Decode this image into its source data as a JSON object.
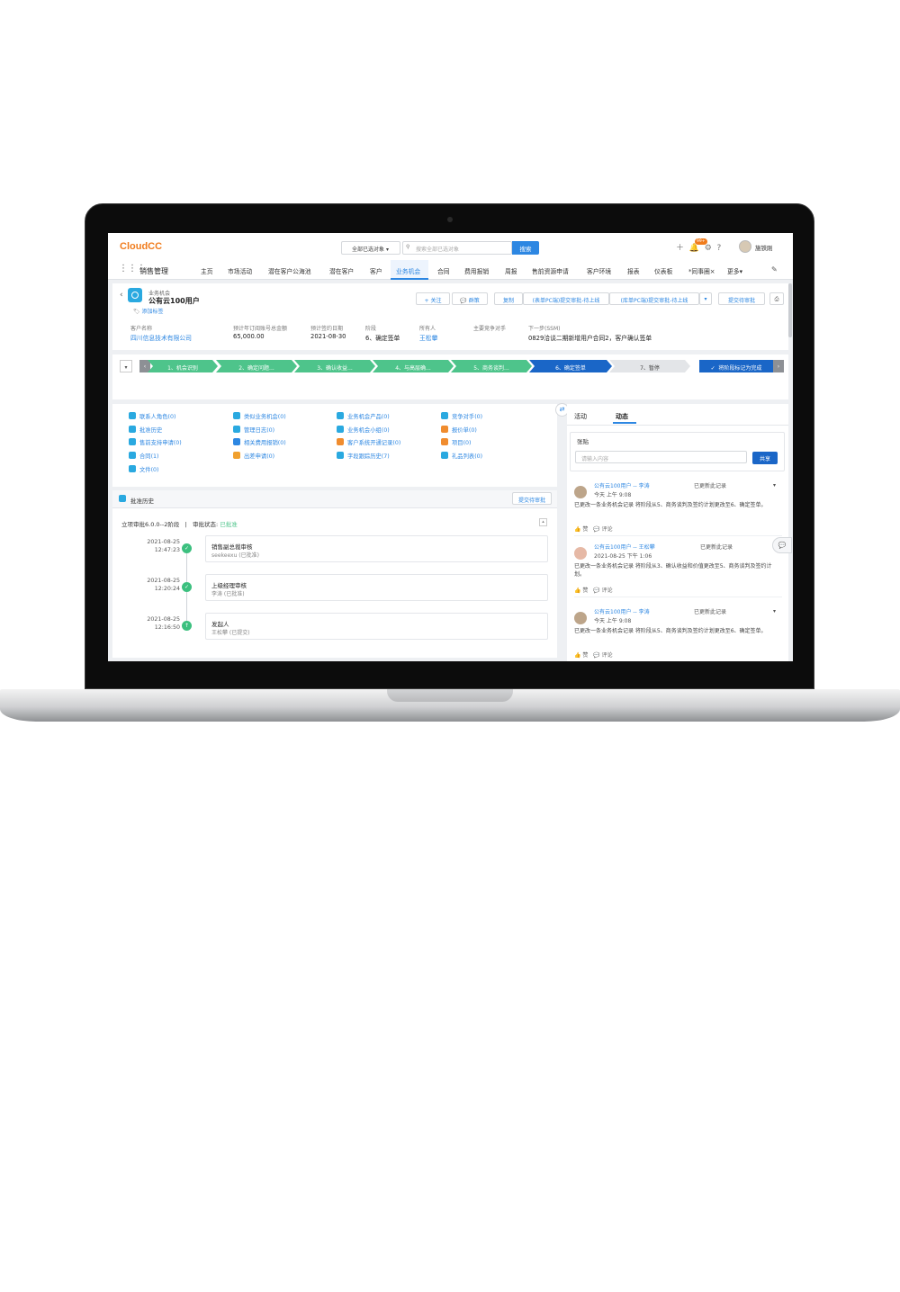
{
  "topbar": {
    "logo": "CloudCC",
    "scope": "全部已选对象",
    "search_placeholder": "搜索全部已选对象",
    "search_button": "搜索",
    "badge": "99+",
    "user_name": "施铁刚"
  },
  "nav": {
    "app_name": "销售管理",
    "items": [
      "主页",
      "市场活动",
      "潜在客户公海池",
      "潜在客户",
      "客户",
      "业务机会",
      "合同",
      "费用报销",
      "周报",
      "售前资源申请",
      "客户环境",
      "报表",
      "仪表板",
      "*同事圈×",
      "更多"
    ],
    "active": "业务机会"
  },
  "record": {
    "object_type": "业务机会",
    "title": "公有云100用户",
    "add_tag": "添加标签",
    "buttons": [
      "+ 关注",
      "群策",
      "复制",
      "(表单PC端)提交审批-待上线",
      "(库单PC端)提交审批-待上线",
      "提交待审批"
    ],
    "fields": [
      {
        "label": "客户名称",
        "value": "四川信息技术有限公司"
      },
      {
        "label": "预计年订阅账号总金额",
        "value": "65,000.00"
      },
      {
        "label": "预计签约日期",
        "value": "2021-08-30"
      },
      {
        "label": "阶段",
        "value": "6、确定签单"
      },
      {
        "label": "所有人",
        "value": "王松攀"
      },
      {
        "label": "主要竞争对手",
        "value": ""
      },
      {
        "label": "下一步(SSM)",
        "value": "0829洽谈二期新增用户合同2，客户确认签单"
      }
    ]
  },
  "path": {
    "stages": [
      "1、机会识别",
      "2、确定问题...",
      "3、确认收益...",
      "4、与高层确...",
      "5、商务谈判...",
      "6、确定签单",
      "7、暂停"
    ],
    "current_index": 5,
    "mark_button": "将阶段标记为完成"
  },
  "related": {
    "items": [
      "联系人角色(0)",
      "类似业务机会(0)",
      "业务机会产品(0)",
      "竞争对手(0)",
      "批准历史",
      "管理日志(0)",
      "业务机会小组(0)",
      "报价单(0)",
      "售前支持申请(0)",
      "相关费用报销(0)",
      "客户系统开通记录(0)",
      "项目(0)",
      "合同(1)",
      "出差申请(0)",
      "字段跟踪历史(7)",
      "礼品列表(0)",
      "文件(0)"
    ]
  },
  "approval": {
    "title": "批准历史",
    "submit_button": "提交待审批",
    "process": "立项审批6.0.0--2阶段",
    "status_label": "审批状态:",
    "status_value": "已批准",
    "steps": [
      {
        "date": "2021-08-25",
        "time": "12:47:23",
        "title": "销售副总裁审核",
        "sub": "seekeexu (已批准)"
      },
      {
        "date": "2021-08-25",
        "time": "12:20:24",
        "title": "上级经理审核",
        "sub": "李涛 (已批准)"
      },
      {
        "date": "2021-08-25",
        "time": "12:16:50",
        "title": "发起人",
        "sub": "王松攀 (已提交)"
      }
    ]
  },
  "feed": {
    "tabs": [
      "活动",
      "动态"
    ],
    "active_tab": "动态",
    "post_tab": "张贴",
    "input_placeholder": "请输入内容",
    "share_button": "共享",
    "items": [
      {
        "title": "公有云100用户 -- 李涛",
        "time": "今天 上午 9:08",
        "action": "已更新此记录",
        "body": "已更改一条业务机会记录 将阶段从5、商务谈判及签约计划更改至6、确定签单。",
        "like": "赞",
        "comment": "评论"
      },
      {
        "title": "公有云100用户 -- 王松攀",
        "time": "2021-08-25 下午 1:06",
        "action": "已更新此记录",
        "body": "已更改一条业务机会记录 将阶段从3、确认收益和价值更改至5、商务谈判及签约计划。",
        "like": "赞",
        "comment": "评论"
      },
      {
        "title": "公有云100用户 -- 李涛",
        "time": "今天 上午 9:08",
        "action": "已更新此记录",
        "body": "已更改一条业务机会记录 将阶段从5、商务谈判及签约计划更改至6、确定签单。",
        "like": "赞",
        "comment": "评论"
      }
    ]
  },
  "colors": {
    "accent": "#2d87e2",
    "done": "#4ec48b",
    "current": "#1a66c7",
    "logo": "#f07c1d"
  }
}
